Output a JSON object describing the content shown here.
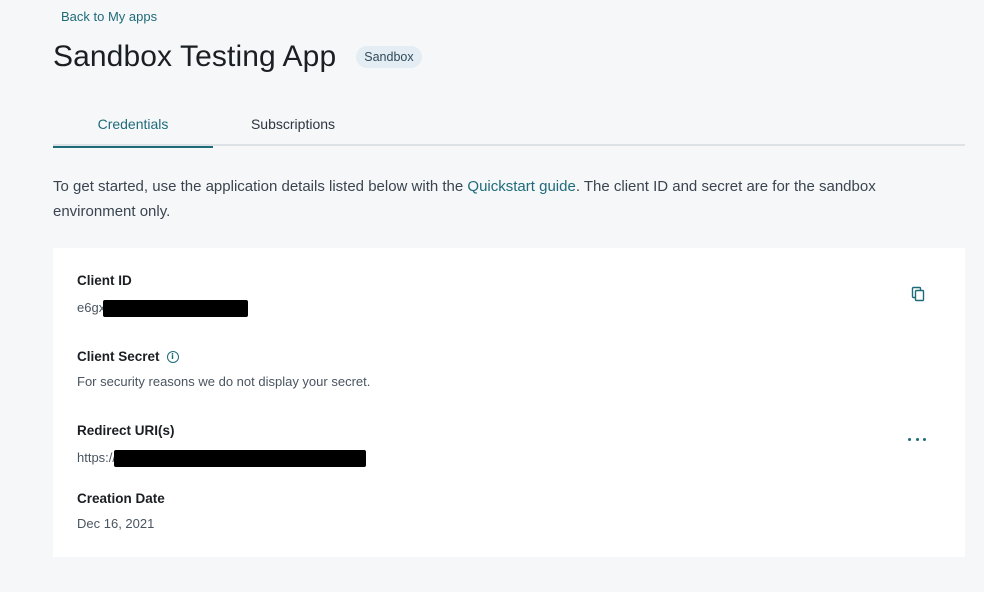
{
  "nav": {
    "back_label": "Back to My apps"
  },
  "app": {
    "title": "Sandbox Testing App",
    "environment_badge": "Sandbox"
  },
  "tabs": [
    {
      "label": "Credentials",
      "active": true
    },
    {
      "label": "Subscriptions",
      "active": false
    }
  ],
  "intro": {
    "text_before": "To get started, use the application details listed below with the ",
    "link_text": "Quickstart guide",
    "text_after": ". The client ID and secret are for the sandbox environment only."
  },
  "credentials": {
    "client_id": {
      "label": "Client ID",
      "value_prefix": "e6gx"
    },
    "client_secret": {
      "label": "Client Secret",
      "note": "For security reasons we do not display your secret."
    },
    "redirect_uris": {
      "label": "Redirect URI(s)",
      "value_prefix": "https://"
    },
    "creation_date": {
      "label": "Creation Date",
      "value": "Dec 16, 2021"
    }
  },
  "icons": {
    "copy": "copy-icon",
    "info": "info-icon",
    "more": "more-horizontal-icon"
  },
  "colors": {
    "accent": "#1f6b79",
    "background": "#f6f7f9",
    "badge_bg": "#e3edf3",
    "card_bg": "#ffffff"
  }
}
